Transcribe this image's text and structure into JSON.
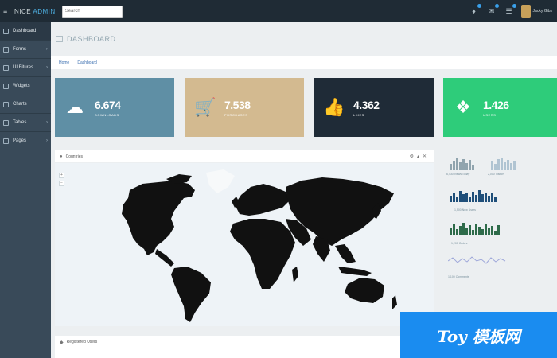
{
  "topbar": {
    "brand_main": "NICE",
    "brand_accent": "ADMIN",
    "search_placeholder": "Search",
    "username": "Jacky Gibs"
  },
  "sidebar": {
    "items": [
      {
        "label": "Dashboard",
        "icon": "home-icon"
      },
      {
        "label": "Forms",
        "icon": "form-icon"
      },
      {
        "label": "UI Fitures",
        "icon": "laptop-icon"
      },
      {
        "label": "Widgets",
        "icon": "widget-icon"
      },
      {
        "label": "Charts",
        "icon": "chart-icon"
      },
      {
        "label": "Tables",
        "icon": "table-icon"
      },
      {
        "label": "Pages",
        "icon": "pages-icon"
      }
    ]
  },
  "page": {
    "title": "DASHBOARD",
    "breadcrumb": [
      "Home",
      "Dashboard"
    ]
  },
  "cards": [
    {
      "value": "6.674",
      "label": "DOWNLOADS",
      "color": "#5f8fa5",
      "icon": "cloud-download-icon"
    },
    {
      "value": "7.538",
      "label": "PURCHASES",
      "color": "#d3ba90",
      "icon": "cart-icon"
    },
    {
      "value": "4.362",
      "label": "LIKES",
      "color": "#1f2b37",
      "icon": "thumbs-up-icon"
    },
    {
      "value": "1.426",
      "label": "USERS",
      "color": "#2ecc7a",
      "icon": "cubes-icon"
    }
  ],
  "map_panel": {
    "title": "Countries"
  },
  "sparklines": [
    {
      "label": "6,430 Views Today",
      "color": "#90a4ae"
    },
    {
      "label": "2,000 Visitors",
      "color": "#b0c4d2"
    },
    {
      "label": "1,500 New Users",
      "color": "#1f4f7a"
    },
    {
      "label": "1,200 Orders",
      "color": "#2e6b4a"
    },
    {
      "label": "1,100 Comments",
      "color": "#9fa8da"
    }
  ],
  "bottom_panel": {
    "title": "Registered Users"
  },
  "watermark": {
    "text": "Toy 模板网"
  }
}
